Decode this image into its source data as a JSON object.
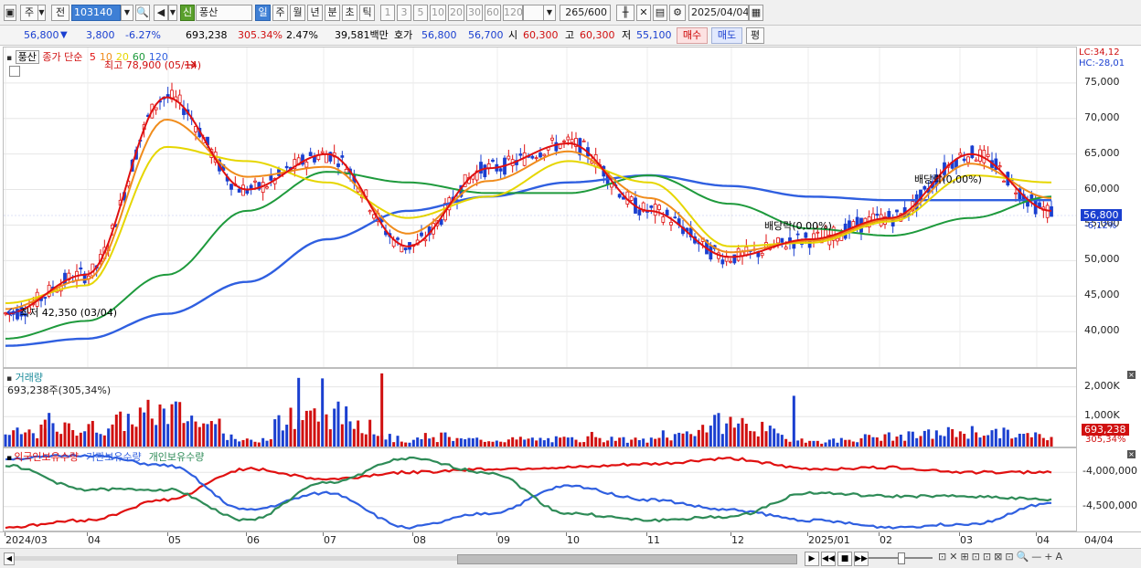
{
  "toolbar": {
    "period_mode": "주",
    "prev_label": "전",
    "code": "103140",
    "name": "풍산",
    "credit_badge": "신",
    "period_tabs": [
      "일",
      "주",
      "월",
      "년",
      "분",
      "초",
      "틱"
    ],
    "active_period": "일",
    "intervals": [
      "1",
      "3",
      "5",
      "10",
      "20",
      "30",
      "60",
      "120"
    ],
    "count": "265",
    "count_total": "/600",
    "date": "2025/04/04"
  },
  "quote": {
    "price": "56,800",
    "change": "3,800",
    "change_pct": "-6.27%",
    "volume": "693,238",
    "volume_ratio": "305.34%",
    "turnover": "2.47%",
    "amount": "39,581백만",
    "hoga_label": "호가",
    "ask": "56,800",
    "bid": "56,700",
    "open_label": "시",
    "open": "60,300",
    "high_label": "고",
    "high": "60,300",
    "low_label": "저",
    "low": "55,100",
    "buy_label": "매수",
    "sell_label": "매도",
    "eval_label": "평"
  },
  "price_panel": {
    "stock_tag": "풍산",
    "ma_legend_prefix": "종가 단순",
    "ma_periods": [
      {
        "label": "5",
        "color": "#e01010"
      },
      {
        "label": "10",
        "color": "#f08c1c"
      },
      {
        "label": "20",
        "color": "#e6d600"
      },
      {
        "label": "60",
        "color": "#1e9a3c"
      },
      {
        "label": "120",
        "color": "#2f5fe0"
      }
    ],
    "high_note": "최고 78,900 (05/14)",
    "low_note": "최저 42,350 (03/04)",
    "dividend_note_1": "배당락(0,00%)",
    "dividend_note_2": "배당락(0,00%)",
    "lc": "LC:34,12",
    "hc": "HC:-28,01",
    "last_price_box": "56,800",
    "last_change_pct": "-6,12%"
  },
  "volume_panel": {
    "title": "거래량",
    "value_note": "693,238주(305,34%)",
    "box_value": "693,238",
    "box_pct": "305,34%"
  },
  "holding_panel": {
    "legend": [
      {
        "label": "외국인보유수량",
        "color": "#e01010"
      },
      {
        "label": "기관보유수량",
        "color": "#2f5fe0"
      },
      {
        "label": "개인보유수량",
        "color": "#2e8b57"
      }
    ]
  },
  "x_axis": [
    "2024/03",
    "04",
    "05",
    "06",
    "07",
    "08",
    "09",
    "10",
    "11",
    "12",
    "2025/01",
    "02",
    "03",
    "04"
  ],
  "x_axis_end": "04/04",
  "chart_data": [
    {
      "type": "line",
      "title": "풍산 일봉 (종가 단순 이동평균)",
      "note": "candlestick price series with moving averages 5/10/20/60/120",
      "ylim": [
        35000,
        80000
      ],
      "y_ticks": [
        "75,000",
        "70,000",
        "65,000",
        "60,000",
        "55,000",
        "50,000",
        "45,000",
        "40,000"
      ],
      "y_tick_values": [
        75000,
        70000,
        65000,
        60000,
        55000,
        50000,
        45000,
        40000
      ],
      "x": [
        "2024/03",
        "04",
        "05",
        "06",
        "07",
        "08",
        "09",
        "10",
        "11",
        "12",
        "2025/01",
        "02",
        "03",
        "04"
      ],
      "series": [
        {
          "name": "5",
          "values": [
            42500,
            48000,
            73000,
            60000,
            65000,
            52000,
            63000,
            66500,
            57000,
            50500,
            53000,
            56000,
            65000,
            57000
          ]
        },
        {
          "name": "20",
          "values": [
            44000,
            46500,
            66000,
            64000,
            61000,
            56000,
            59000,
            64000,
            61000,
            52000,
            52500,
            55500,
            62000,
            61000
          ]
        },
        {
          "name": "60",
          "values": [
            39000,
            41500,
            48000,
            57000,
            62500,
            61000,
            59500,
            59500,
            62000,
            58000,
            54500,
            53500,
            56000,
            59000
          ]
        },
        {
          "name": "120",
          "values": [
            38000,
            39000,
            42500,
            47000,
            53000,
            57000,
            59000,
            61000,
            62000,
            60500,
            59000,
            58500,
            58500,
            58500
          ]
        }
      ]
    },
    {
      "type": "bar",
      "title": "거래량",
      "ylim": [
        0,
        2600000
      ],
      "y_ticks": [
        "2,000K",
        "1,000K"
      ],
      "y_tick_values": [
        2000000,
        1000000
      ],
      "x": [
        "2024/03",
        "04",
        "05",
        "06",
        "07",
        "08",
        "09",
        "10",
        "11",
        "12",
        "2025/01",
        "02",
        "03",
        "04"
      ],
      "values": [
        900000,
        1300000,
        2450000,
        400000,
        2300000,
        450000,
        500000,
        500000,
        450000,
        1700000,
        350000,
        700000,
        1050000,
        693238
      ]
    },
    {
      "type": "line",
      "title": "보유수량",
      "ylim": [
        -4850000,
        -3650000
      ],
      "y_ticks": [
        "-4,000,000",
        "-4,500,000"
      ],
      "y_tick_values": [
        -4000000,
        -4500000
      ],
      "x": [
        "2024/03",
        "04",
        "05",
        "06",
        "07",
        "08",
        "09",
        "10",
        "11",
        "12",
        "2025/01",
        "02",
        "03",
        "04"
      ],
      "series": [
        {
          "name": "외국인보유수량",
          "values": [
            -4800000,
            -4700000,
            -4400000,
            -3950000,
            -4100000,
            -4000000,
            -3950000,
            -3930000,
            -3880000,
            -3800000,
            -3950000,
            -3930000,
            -4000000,
            -4000000
          ]
        },
        {
          "name": "기관보유수량",
          "values": [
            -3800000,
            -3750000,
            -3900000,
            -4550000,
            -4300000,
            -4800000,
            -4600000,
            -4200000,
            -4400000,
            -4550000,
            -4700000,
            -4800000,
            -4750000,
            -4450000
          ]
        },
        {
          "name": "개인보유수량",
          "values": [
            -3900000,
            -4250000,
            -4250000,
            -4700000,
            -4150000,
            -3800000,
            -4000000,
            -4600000,
            -4700000,
            -4650000,
            -4300000,
            -4350000,
            -4350000,
            -4400000
          ]
        }
      ]
    }
  ]
}
